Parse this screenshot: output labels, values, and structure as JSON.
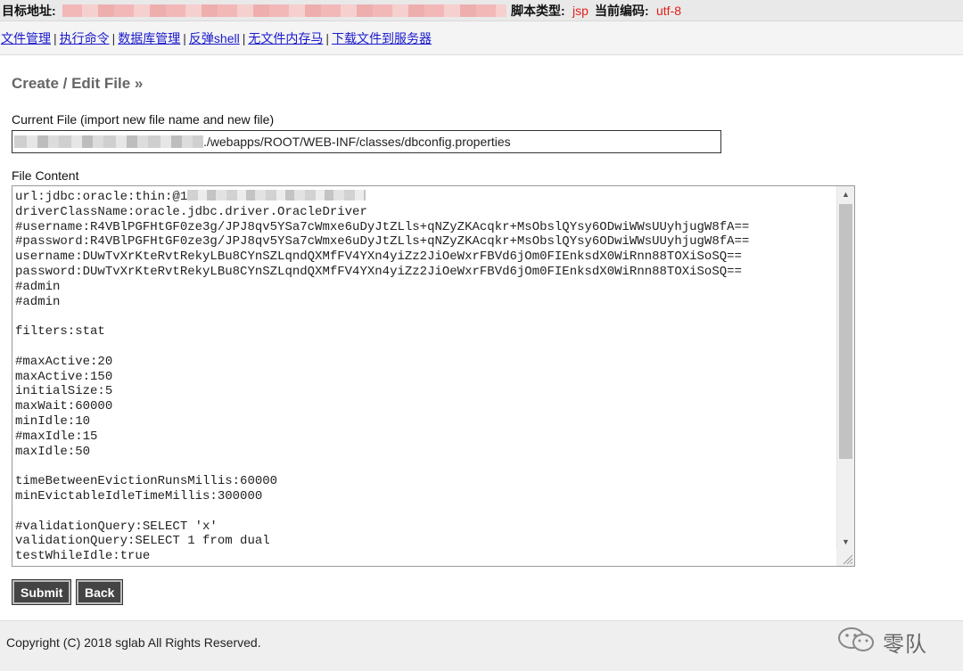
{
  "header": {
    "target_label": "目标地址:",
    "script_type_label": "脚本类型:",
    "script_type_value": "jsp",
    "encoding_label": "当前编码:",
    "encoding_value": "utf-8"
  },
  "nav": {
    "items": [
      {
        "label": "文件管理"
      },
      {
        "label": "执行命令"
      },
      {
        "label": "数据库管理"
      },
      {
        "label": "反弹shell"
      },
      {
        "label": "无文件内存马"
      },
      {
        "label": "下载文件到服务器"
      }
    ],
    "separator": "|"
  },
  "page": {
    "title": "Create / Edit File »",
    "current_file_label": "Current File (import new file name and new file)",
    "current_file_value_suffix": "./webapps/ROOT/WEB-INF/classes/dbconfig.properties",
    "file_content_label": "File Content",
    "file_content_first_prefix": "url:jdbc:oracle:thin:@1",
    "file_content_rest": "driverClassName:oracle.jdbc.driver.OracleDriver\n#username:R4VBlPGFHtGF0ze3g/JPJ8qv5YSa7cWmxe6uDyJtZLls+qNZyZKAcqkr+MsObslQYsy6ODwiWWsUUyhjugW8fA==\n#password:R4VBlPGFHtGF0ze3g/JPJ8qv5YSa7cWmxe6uDyJtZLls+qNZyZKAcqkr+MsObslQYsy6ODwiWWsUUyhjugW8fA==\nusername:DUwTvXrKteRvtRekyLBu8CYnSZLqndQXMfFV4YXn4yiZz2JiOeWxrFBVd6jOm0FIEnksdX0WiRnn88TOXiSoSQ==\npassword:DUwTvXrKteRvtRekyLBu8CYnSZLqndQXMfFV4YXn4yiZz2JiOeWxrFBVd6jOm0FIEnksdX0WiRnn88TOXiSoSQ==\n#admin\n#admin\n\nfilters:stat\n\n#maxActive:20\nmaxActive:150\ninitialSize:5\nmaxWait:60000\nminIdle:10\n#maxIdle:15\nmaxIdle:50\n\ntimeBetweenEvictionRunsMillis:60000\nminEvictableIdleTimeMillis:300000\n\n#validationQuery:SELECT 'x'\nvalidationQuery:SELECT 1 from dual\ntestWhileIdle:true",
    "submit_label": "Submit",
    "back_label": "Back"
  },
  "footer": {
    "copyright": "Copyright (C) 2018 sglab All Rights Reserved.",
    "brand": "零队",
    "brand_icon": "wechat-icon"
  },
  "colors": {
    "value_red": "#e0201b",
    "link_blue": "#1a1acc",
    "button_bg": "#444444"
  }
}
